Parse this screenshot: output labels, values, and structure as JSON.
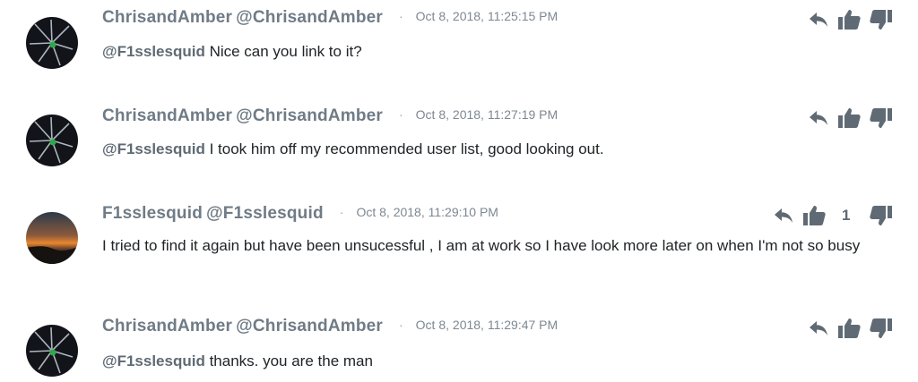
{
  "comments": [
    {
      "author": "ChrisandAmber",
      "handle": "@ChrisandAmber",
      "separator": "·",
      "timestamp": "Oct 8, 2018, 11:25:15 PM",
      "mention": "@F1sslesquid",
      "text": " Nice can you link to it?",
      "avatar": "avatar-dark-starburst",
      "upvotes": ""
    },
    {
      "author": "ChrisandAmber",
      "handle": "@ChrisandAmber",
      "separator": "·",
      "timestamp": "Oct 8, 2018, 11:27:19 PM",
      "mention": "@F1sslesquid",
      "text": " I took him off my recommended user list, good looking out.",
      "avatar": "avatar-dark-starburst",
      "upvotes": ""
    },
    {
      "author": "F1sslesquid",
      "handle": "@F1sslesquid",
      "separator": "·",
      "timestamp": "Oct 8, 2018, 11:29:10 PM",
      "mention": "",
      "text": "I tried to find it again but have been unsucessful , I am at work so I have look more later on when I'm not so busy",
      "avatar": "avatar-sunset",
      "upvotes": "1"
    },
    {
      "author": "ChrisandAmber",
      "handle": "@ChrisandAmber",
      "separator": "·",
      "timestamp": "Oct 8, 2018, 11:29:47 PM",
      "mention": "@F1sslesquid",
      "text": " thanks. you are the man",
      "avatar": "avatar-dark-starburst",
      "upvotes": ""
    }
  ],
  "icons": {
    "reply": "reply-icon",
    "upvote": "thumbs-up-icon",
    "downvote": "thumbs-down-icon"
  },
  "colors": {
    "author": "#6f7b86",
    "text": "#202427",
    "icon": "#5f6a74",
    "timestamp": "#7d8892"
  }
}
